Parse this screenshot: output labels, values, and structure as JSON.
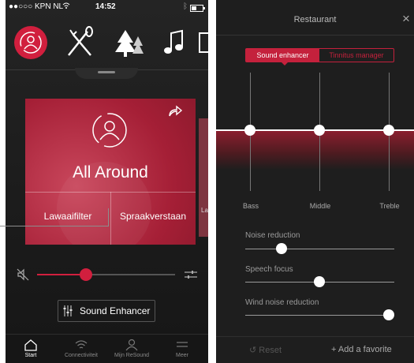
{
  "left": {
    "status": {
      "carrier": "●●○○○ KPN NL",
      "wifi": "wifi-icon",
      "time": "14:52",
      "bluetooth": "bluetooth-icon",
      "battery": "battery-icon"
    },
    "categories": [
      {
        "name": "all-around",
        "icon": "person-cycle-icon",
        "selected": true
      },
      {
        "name": "restaurant",
        "icon": "fork-knife-icon",
        "selected": false
      },
      {
        "name": "outdoor",
        "icon": "tree-icon",
        "selected": false
      },
      {
        "name": "music",
        "icon": "music-note-icon",
        "selected": false
      },
      {
        "name": "tv",
        "icon": "tv-icon",
        "selected": false
      }
    ],
    "program_card": {
      "title": "All Around",
      "option_left": "Lawaaifilter",
      "option_right": "Spraakverstaan",
      "next_card_peek": "Law"
    },
    "volume": {
      "level": 0.35,
      "mute_icon": "speaker-muted-icon",
      "settings_icon": "sliders-icon"
    },
    "sound_enhancer_button": "Sound Enhancer",
    "tabbar": [
      {
        "label": "Start",
        "icon": "home-icon",
        "active": true
      },
      {
        "label": "Connectiviteit",
        "icon": "wifi-icon",
        "active": false
      },
      {
        "label": "Mijn ReSound",
        "icon": "user-icon",
        "active": false
      },
      {
        "label": "Meer",
        "icon": "menu-icon",
        "active": false
      }
    ],
    "colors": {
      "accent": "#d11f3e",
      "card": "#a51f36"
    }
  },
  "right": {
    "title": "Restaurant",
    "close_icon": "close-icon",
    "tabs": [
      {
        "label": "Sound enhancer",
        "active": true
      },
      {
        "label": "Tinnitus manager",
        "active": false
      }
    ],
    "equalizer": {
      "bands": [
        {
          "label": "Bass",
          "level": 0.5
        },
        {
          "label": "Middle",
          "level": 0.5
        },
        {
          "label": "Treble",
          "level": 0.5
        }
      ]
    },
    "sliders": [
      {
        "label": "Noise reduction",
        "value": 0.25
      },
      {
        "label": "Speech focus",
        "value": 0.5
      },
      {
        "label": "Wind noise reduction",
        "value": 1.0
      }
    ],
    "reset_label": "Reset",
    "add_favorite_label": "+ Add a favorite"
  }
}
